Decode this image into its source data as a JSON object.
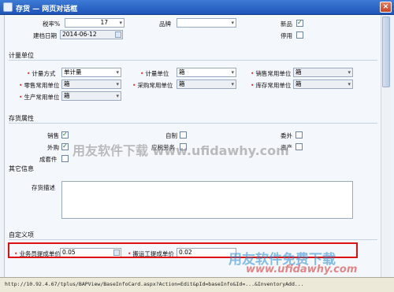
{
  "window": {
    "title": "存货 — 网页对话框",
    "close_label": "×"
  },
  "top_fields": {
    "tax_rate_label": "税率%",
    "tax_rate_value": "17",
    "brand_label": "品牌",
    "brand_value": "",
    "new_product_label": "新品",
    "new_product_checked": true,
    "created_date_label": "建档日期",
    "created_date_value": "2014-06-12",
    "disabled_label": "停用",
    "disabled_checked": false
  },
  "unit_section": {
    "title": "计量单位",
    "measure_method_label": "计量方式",
    "measure_method_value": "单计量",
    "measure_unit_label": "计量单位",
    "measure_unit_value": "箱",
    "sales_unit_label": "销售常用单位",
    "sales_unit_value": "箱",
    "retail_unit_label": "零售常用单位",
    "retail_unit_value": "箱",
    "purchase_unit_label": "采购常用单位",
    "purchase_unit_value": "箱",
    "stock_unit_label": "库存常用单位",
    "stock_unit_value": "箱",
    "production_unit_label": "生产常用单位",
    "production_unit_value": "箱"
  },
  "attr_section": {
    "title": "存货属性",
    "sales_label": "销售",
    "sales_checked": true,
    "selfmade_label": "自制",
    "selfmade_checked": false,
    "outsource_label": "委外",
    "outsource_checked": false,
    "purchase_label": "外购",
    "purchase_checked": true,
    "service_label": "应税劳务",
    "service_checked": false,
    "asset_label": "资产",
    "asset_checked": false,
    "consumable_label": "成套件",
    "consumable_checked": false
  },
  "other_section": {
    "title": "其它信息",
    "desc_label": "存货描述",
    "desc_value": ""
  },
  "custom_section": {
    "title": "自定义项",
    "salesman_price_label": "业务员提成单价",
    "salesman_price_value": "0.05",
    "porter_price_label": "搬运工提成单价",
    "porter_price_value": "0.02"
  },
  "watermarks": {
    "center": "用友软件下载 www.ufidawhy.com",
    "bottom_cn": "用友软件免费下载",
    "bottom_url": "www.ufidawhy.com"
  },
  "statusbar": {
    "url": "http://10.92.4.67/tplus/BAPView/BaseInfoCard.aspx?Action=Edit&pId=baseInfo&Id=...&InventoryAdd..."
  }
}
